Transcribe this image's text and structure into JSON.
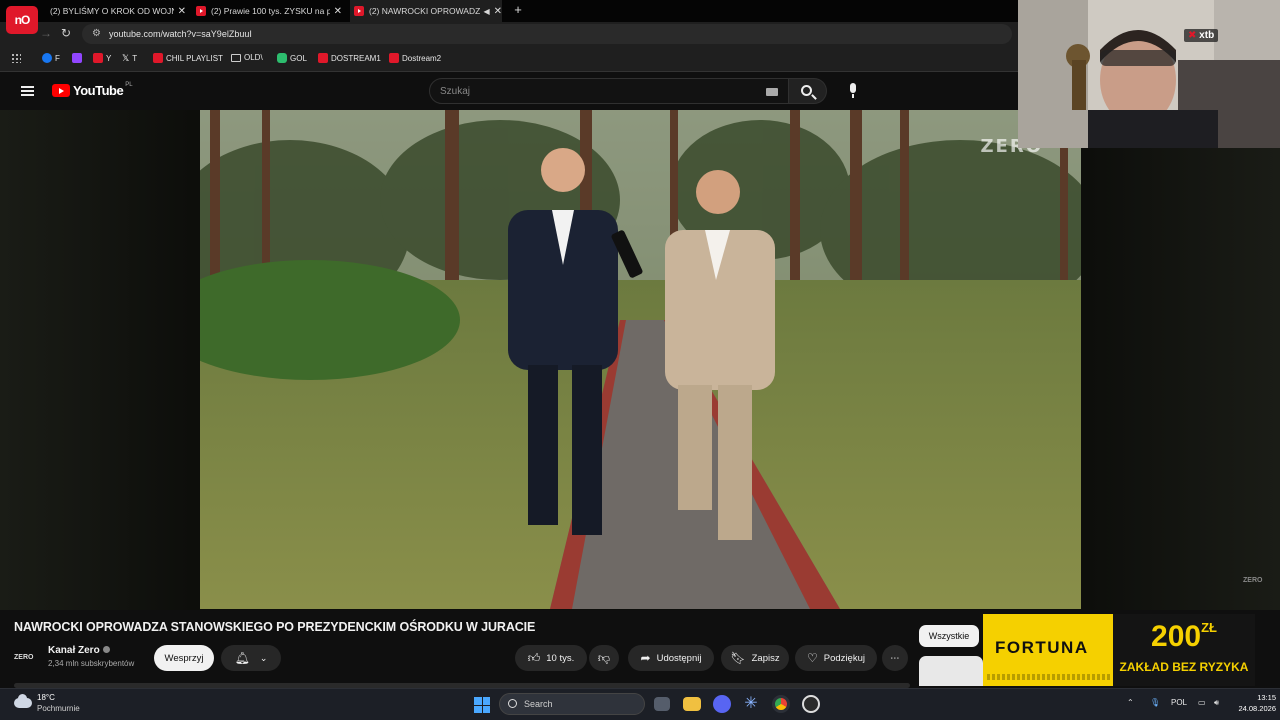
{
  "browser": {
    "tabs": [
      {
        "label": "(2) BYLIŚMY O KROK OD WOJN"
      },
      {
        "label": "(2) Prawie 100 tys. ZYSKU na pi"
      },
      {
        "label": "(2) NAWROCKI OPROWADZ"
      }
    ],
    "new_tab": "+",
    "url": "youtube.com/watch?v=saY9elZbuuI",
    "bookmarks": [
      "F",
      "Y",
      "T",
      "CHIL PLAYLIST",
      "OLD\\",
      "GOL",
      "DOSTREAM1",
      "Dostream2"
    ],
    "corner_logo": "nO"
  },
  "youtube": {
    "brand": "YouTube",
    "country": "PL",
    "search_placeholder": "Szukaj",
    "video_watermark": "ZERO",
    "corner_watermark": "ZERO"
  },
  "video": {
    "title": "NAWROCKI OPROWADZA STANOWSKIEGO PO PREZYDENCKIM OŚRODKU W JURACIE",
    "channel": "Kanał Zero",
    "channel_logo": "ZERO",
    "subscribers": "2,34 mln subskrybentów",
    "support_label": "Wesprzyj",
    "likes": "10 tys.",
    "share_label": "Udostępnij",
    "save_label": "Zapisz",
    "thanks_label": "Podziękuj",
    "more_label": "⋯"
  },
  "sidebar": {
    "chip_all": "Wszystkie"
  },
  "ad": {
    "brand": "FORTUNA",
    "amount": "200",
    "currency": "ZŁ",
    "tagline": "ZAKŁAD BEZ RYZYKA"
  },
  "webcam": {
    "sponsor_tag": "xtb"
  },
  "taskbar": {
    "temperature": "18°C",
    "condition": "Pochmurnie",
    "search_label": "Search",
    "language": "POL",
    "time": "13:15",
    "date": "24.08.2026"
  }
}
